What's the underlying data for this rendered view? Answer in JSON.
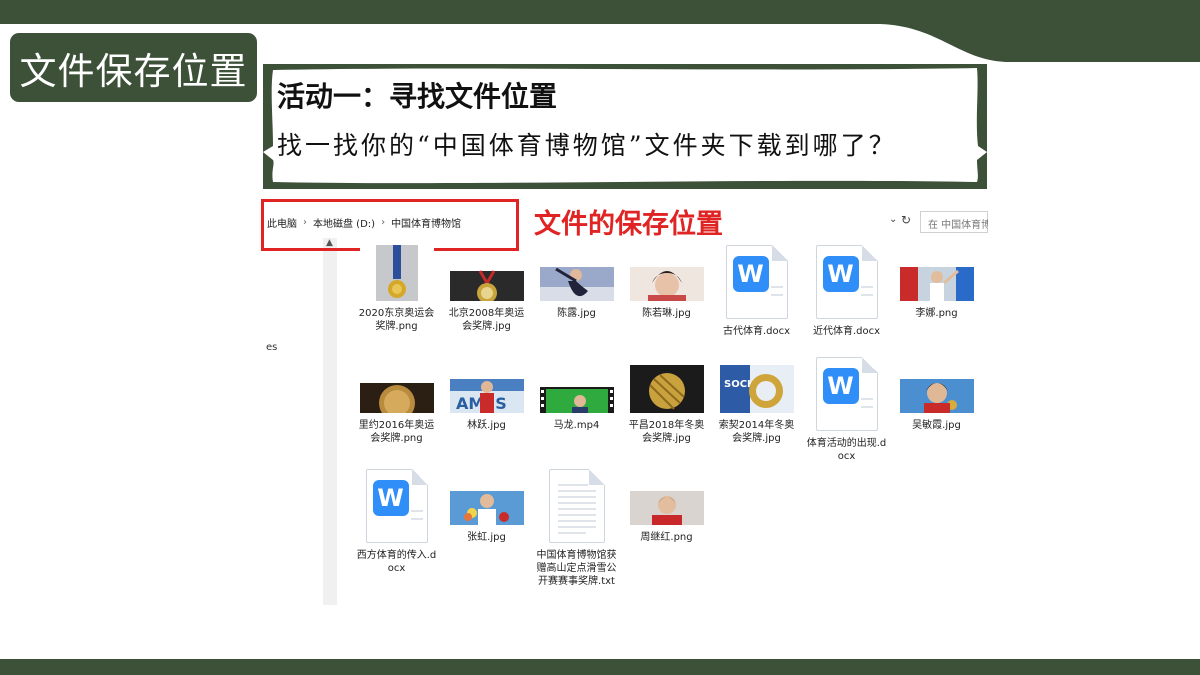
{
  "slide": {
    "title": "文件保存位置",
    "colors": {
      "band": "#3d5139",
      "accent_red": "#e02424",
      "word_blue": "#2f8ef7"
    }
  },
  "activity": {
    "title": "活动一：寻找文件位置",
    "question": "找一找你的“中国体育博物馆”文件夹下载到哪了？"
  },
  "annotation": {
    "label": "文件的保存位置"
  },
  "explorer": {
    "breadcrumb": [
      "此电脑",
      "本地磁盘 (D:)",
      "中国体育博物馆"
    ],
    "search_placeholder": "在 中国体育博",
    "side_label": "es",
    "files": [
      {
        "name": "2020东京奥运会奖牌.png",
        "kind": "image",
        "icon": "gold-medal-thumbnail"
      },
      {
        "name": "北京2008年奥运会奖牌.jpg",
        "kind": "image",
        "icon": "jade-medal-thumbnail"
      },
      {
        "name": "陈露.jpg",
        "kind": "image",
        "icon": "skater-photo-thumbnail"
      },
      {
        "name": "陈若琳.jpg",
        "kind": "image",
        "icon": "athlete-portrait-thumbnail"
      },
      {
        "name": "古代体育.docx",
        "kind": "docx",
        "icon": "word-document-icon"
      },
      {
        "name": "近代体育.docx",
        "kind": "docx",
        "icon": "word-document-icon"
      },
      {
        "name": "李娜.png",
        "kind": "image",
        "icon": "tennis-photo-thumbnail"
      },
      {
        "name": "里约2016年奥运会奖牌.png",
        "kind": "image",
        "icon": "rio-medal-thumbnail"
      },
      {
        "name": "林跃.jpg",
        "kind": "image",
        "icon": "diver-photo-thumbnail"
      },
      {
        "name": "马龙.mp4",
        "kind": "video",
        "icon": "video-thumbnail"
      },
      {
        "name": "平昌2018年冬奥会奖牌.jpg",
        "kind": "image",
        "icon": "pyeongchang-medal-thumbnail"
      },
      {
        "name": "索契2014年冬奥会奖牌.jpg",
        "kind": "image",
        "icon": "sochi-medal-thumbnail"
      },
      {
        "name": "体育活动的出现.docx",
        "kind": "docx",
        "icon": "word-document-icon"
      },
      {
        "name": "吴敏霞.jpg",
        "kind": "image",
        "icon": "diver-medal-photo-thumbnail"
      },
      {
        "name": "西方体育的传入.docx",
        "kind": "docx",
        "icon": "word-document-icon"
      },
      {
        "name": "张虹.jpg",
        "kind": "image",
        "icon": "flowers-photo-thumbnail"
      },
      {
        "name": "中国体育博物馆获赠高山定点滑雪公开赛赛事奖牌.txt",
        "kind": "txt",
        "icon": "text-document-icon"
      },
      {
        "name": "周继红.png",
        "kind": "image",
        "icon": "athlete-photo-thumbnail"
      }
    ]
  }
}
